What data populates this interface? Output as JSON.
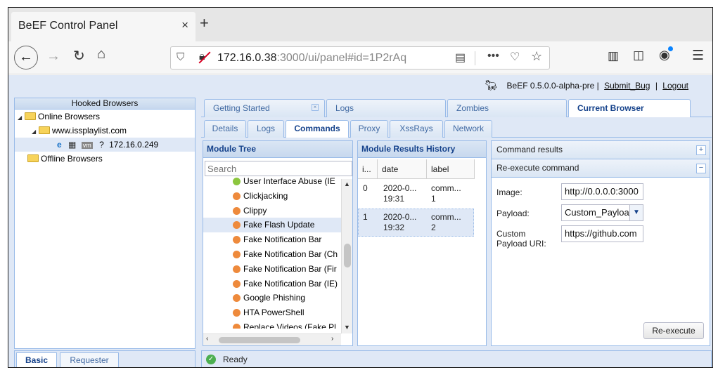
{
  "browser": {
    "tab_title": "BeEF Control Panel",
    "tab_close": "×",
    "new_tab": "+",
    "url_host": "172.16.0.38",
    "url_rest": ":3000/ui/panel#id=1P2rAq"
  },
  "beef": {
    "version": "BeEF  0.5.0.0-alpha-pre",
    "submit_bug": "Submit_Bug",
    "logout": "Logout",
    "sep": "|"
  },
  "hooked": {
    "title": "Hooked Browsers",
    "online": "Online Browsers",
    "domain": "www.issplaylist.com",
    "host": "172.16.0.249",
    "offline": "Offline Browsers"
  },
  "left_tabs": [
    "Basic",
    "Requester"
  ],
  "top_tabs": [
    "Getting Started",
    "Logs",
    "Zombies",
    "Current Browser"
  ],
  "sub_tabs": [
    "Details",
    "Logs",
    "Commands",
    "Proxy",
    "XssRays",
    "Network"
  ],
  "module_tree": {
    "title": "Module Tree",
    "search_placeholder": "Search",
    "items": [
      {
        "label": "User Interface Abuse (IE",
        "status": "green"
      },
      {
        "label": "Clickjacking",
        "status": "orange"
      },
      {
        "label": "Clippy",
        "status": "orange"
      },
      {
        "label": "Fake Flash Update",
        "status": "orange"
      },
      {
        "label": "Fake Notification Bar",
        "status": "orange"
      },
      {
        "label": "Fake Notification Bar (Ch",
        "status": "orange"
      },
      {
        "label": "Fake Notification Bar (Fir",
        "status": "orange"
      },
      {
        "label": "Fake Notification Bar (IE)",
        "status": "orange"
      },
      {
        "label": "Google Phishing",
        "status": "orange"
      },
      {
        "label": "HTA PowerShell",
        "status": "orange"
      },
      {
        "label": "Replace Videos (Fake Pl",
        "status": "orange"
      }
    ]
  },
  "results": {
    "title": "Module Results History",
    "columns": [
      "i...",
      "date",
      "label"
    ],
    "rows": [
      {
        "id": "0",
        "date1": "2020-0...",
        "date2": "19:31",
        "label1": "comm...",
        "label2": "1"
      },
      {
        "id": "1",
        "date1": "2020-0...",
        "date2": "19:32",
        "label1": "comm...",
        "label2": "2"
      }
    ]
  },
  "command": {
    "results_title": "Command results",
    "reexec_title": "Re-execute command",
    "image_label": "Image:",
    "image_value": "http://0.0.0.0:3000",
    "payload_label": "Payload:",
    "payload_value": "Custom_Payload",
    "uri_label_1": "Custom",
    "uri_label_2": "Payload URI:",
    "uri_value": "https://github.com",
    "button": "Re-execute"
  },
  "status": "Ready",
  "colors": {
    "accent": "#15428b",
    "panel_bg": "#dfe8f6",
    "border": "#99bbe8",
    "bullet_orange": "#ee8a3c",
    "bullet_green": "#8cc63e"
  },
  "icons": [
    "back-icon",
    "forward-icon",
    "reload-icon",
    "home-icon",
    "shield-icon",
    "insecure-lock-icon",
    "reader-icon",
    "more-icon",
    "pocket-icon",
    "star-icon",
    "library-icon",
    "sidebar-icon",
    "account-icon",
    "menu-icon",
    "beef-logo-icon",
    "ie-icon",
    "windows-icon",
    "vm-icon",
    "unknown-icon",
    "folder-icon",
    "ok-icon"
  ]
}
